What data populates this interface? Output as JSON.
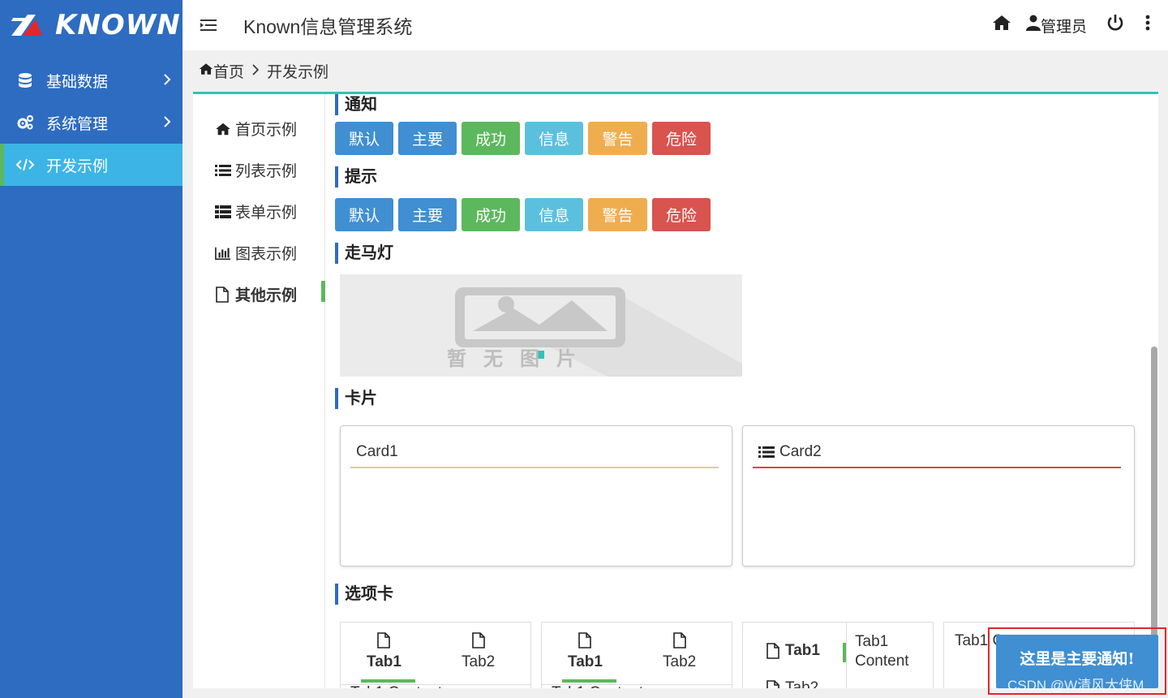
{
  "app": {
    "logo_text": "KNOWN",
    "title": "Known信息管理系统"
  },
  "sidebar": {
    "items": [
      {
        "label": "基础数据",
        "icon": "database-icon"
      },
      {
        "label": "系统管理",
        "icon": "gears-icon"
      },
      {
        "label": "开发示例",
        "icon": "code-icon"
      }
    ]
  },
  "header": {
    "user_label": "管理员"
  },
  "breadcrumb": {
    "home": "首页",
    "current": "开发示例"
  },
  "subnav": {
    "items": [
      {
        "label": "首页示例",
        "icon": "home-icon"
      },
      {
        "label": "列表示例",
        "icon": "list-icon"
      },
      {
        "label": "表单示例",
        "icon": "table-list-icon"
      },
      {
        "label": "图表示例",
        "icon": "bar-chart-icon"
      },
      {
        "label": "其他示例",
        "icon": "file-icon"
      }
    ]
  },
  "sections": {
    "notice": "通知",
    "tip": "提示",
    "marquee": "走马灯",
    "card": "卡片",
    "tabs": "选项卡"
  },
  "buttons": {
    "default": "默认",
    "primary": "主要",
    "success": "成功",
    "info": "信息",
    "warning": "警告",
    "danger": "危险"
  },
  "carousel": {
    "placeholder": "暂无图片"
  },
  "cards": [
    {
      "title": "Card1",
      "line_color": "#f0c78a"
    },
    {
      "title": "Card2",
      "line_color": "#d9534f"
    }
  ],
  "tabs_demo": {
    "tab1": "Tab1",
    "tab2": "Tab2",
    "content": "Tab1 Content",
    "content_line1": "Tab1",
    "content_line2": "Content"
  },
  "notification": {
    "text": "这里是主要通知!"
  },
  "watermark": "CSDN @W清风大侠M",
  "colors": {
    "sidebar_bg": "#2d6cc0",
    "sidebar_active": "#3cb5e6",
    "accent_green": "#5cb85c",
    "panel_top": "#2ec4b6"
  }
}
